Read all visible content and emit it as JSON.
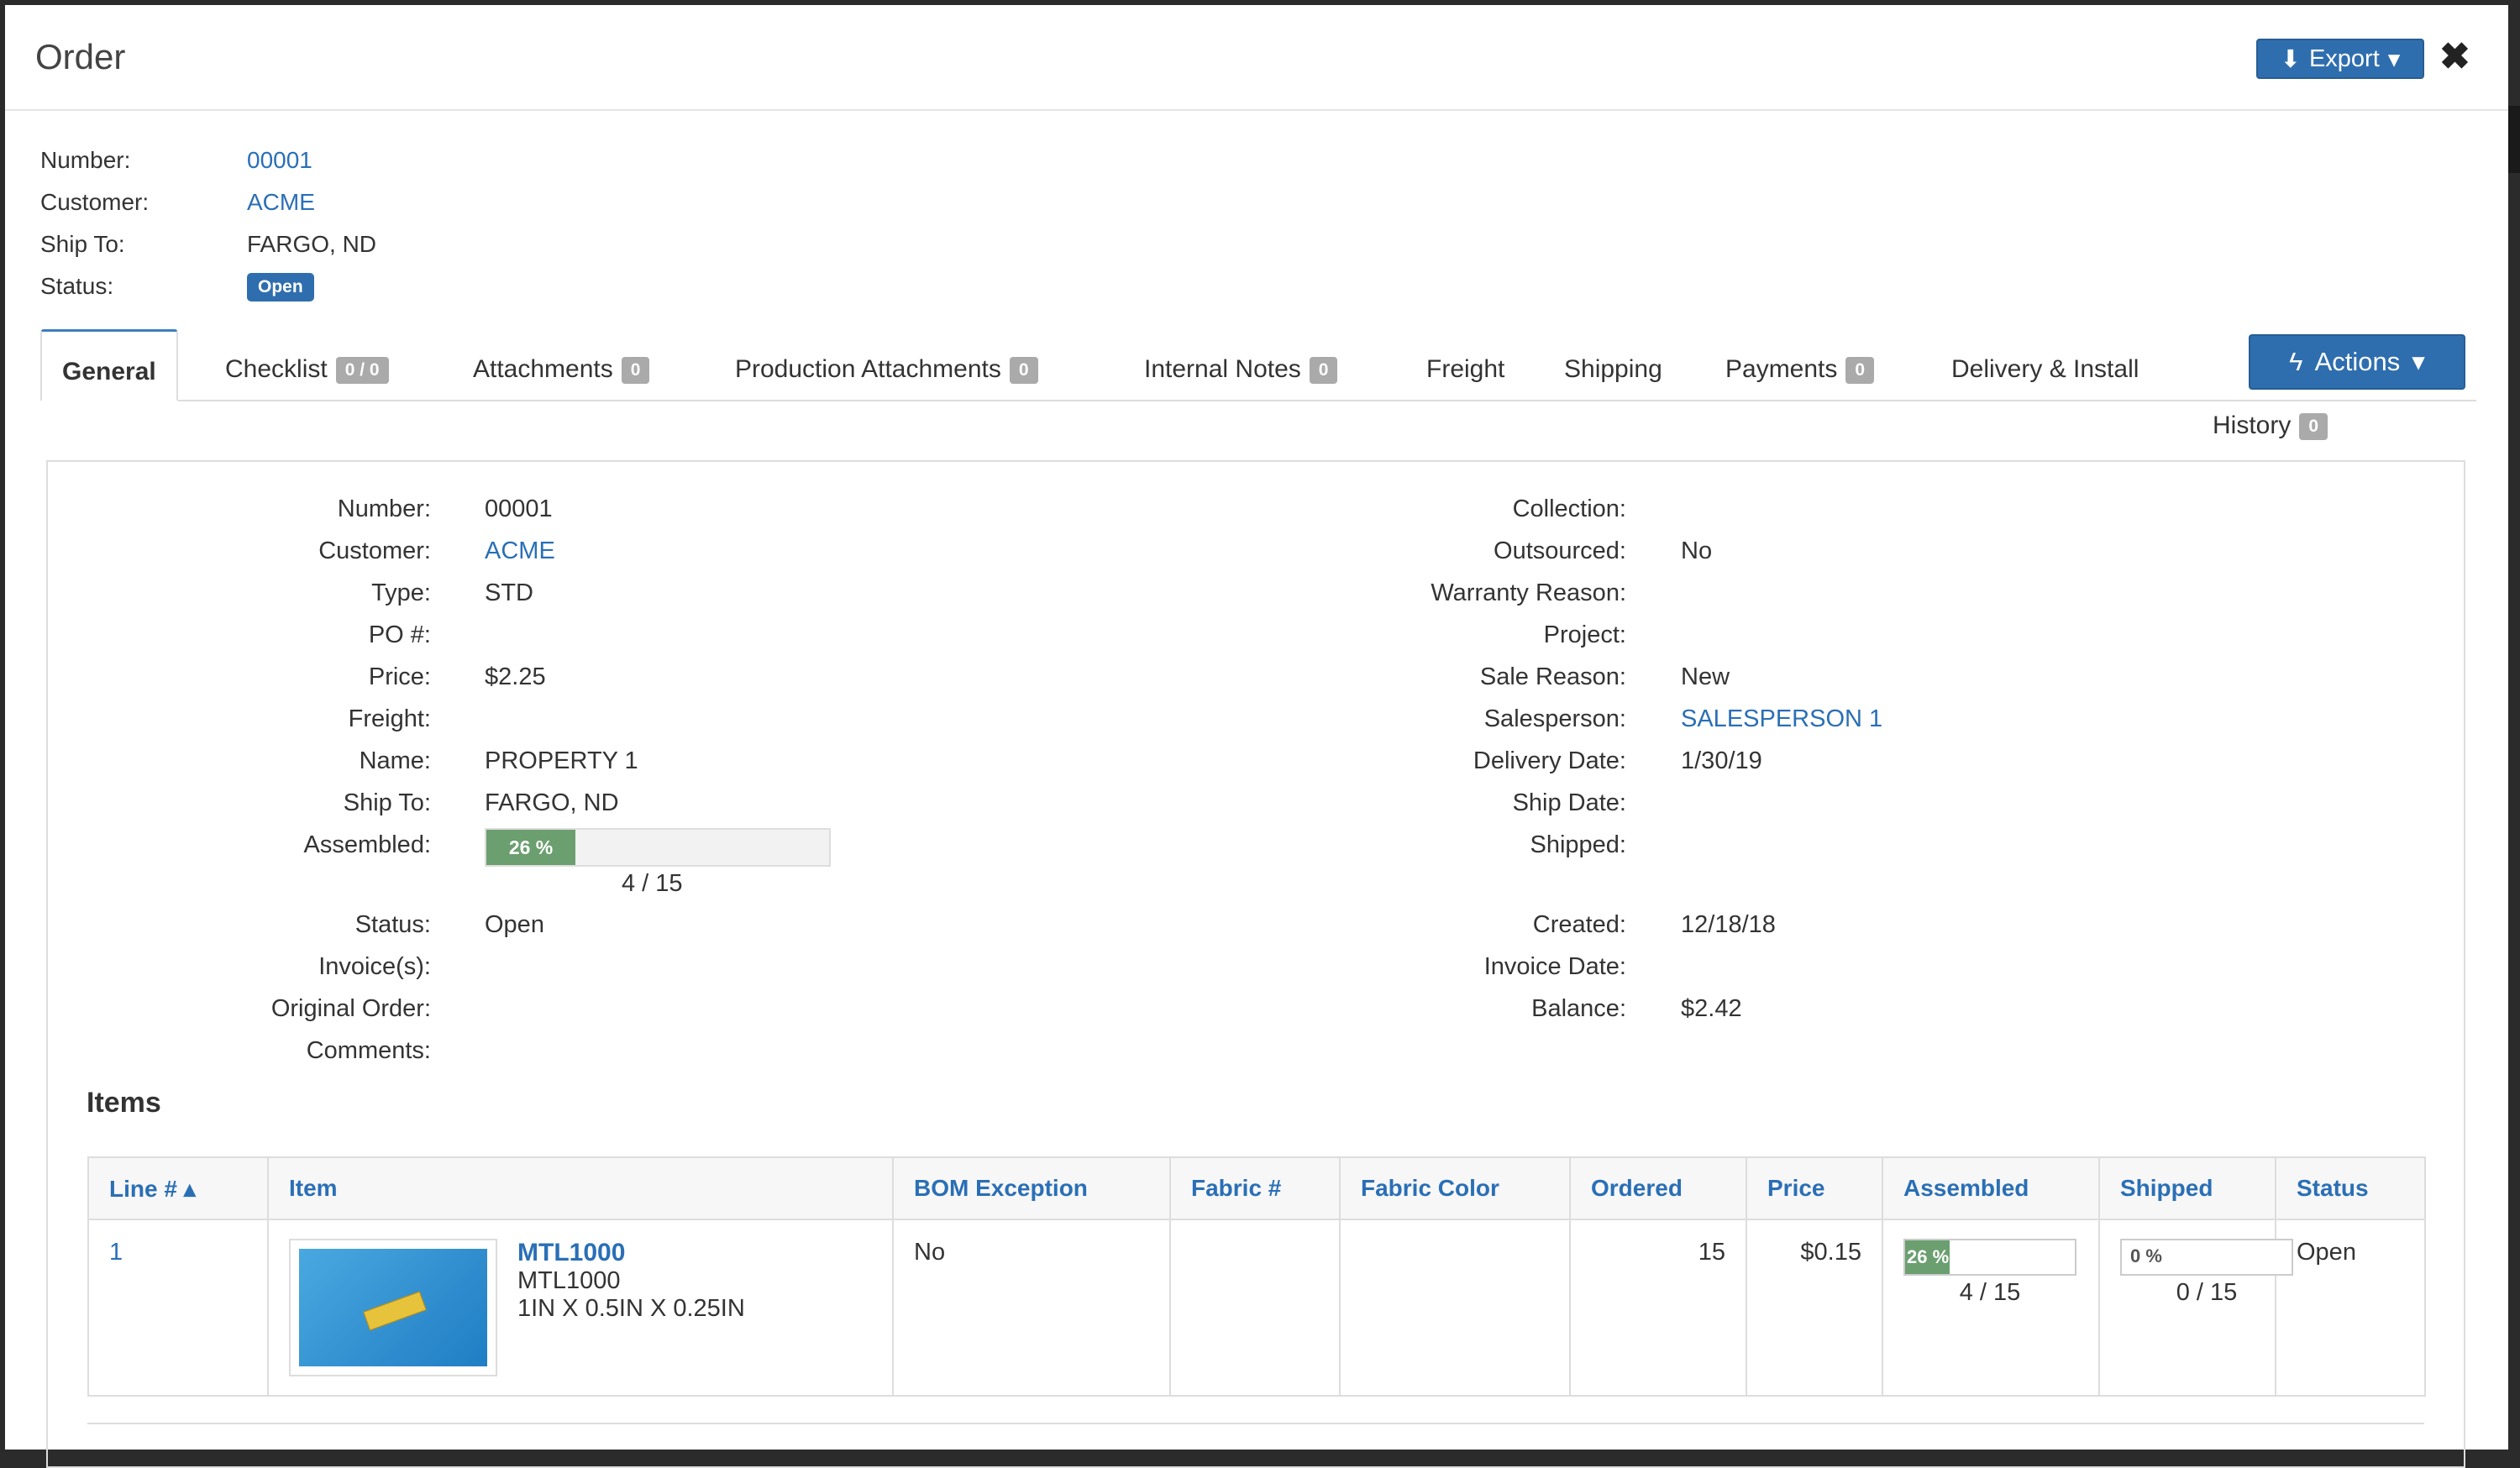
{
  "modal": {
    "title": "Order",
    "export_label": "Export",
    "close_symbol": "✖"
  },
  "header": {
    "number_label": "Number:",
    "number": "00001",
    "customer_label": "Customer:",
    "customer": "ACME",
    "shipto_label": "Ship To:",
    "shipto": "FARGO, ND",
    "status_label": "Status:",
    "status": "Open"
  },
  "tabs": [
    {
      "label": "General"
    },
    {
      "label": "Checklist",
      "count": "0 / 0"
    },
    {
      "label": "Attachments",
      "count": "0"
    },
    {
      "label": "Production Attachments",
      "count": "0"
    },
    {
      "label": "Internal Notes",
      "count": "0"
    },
    {
      "label": "Freight"
    },
    {
      "label": "Shipping"
    },
    {
      "label": "Payments",
      "count": "0"
    },
    {
      "label": "Delivery & Install"
    },
    {
      "label": "History",
      "count": "0"
    }
  ],
  "actions_label": "Actions",
  "left_fields": [
    {
      "label": "Number:",
      "value": "00001"
    },
    {
      "label": "Customer:",
      "value": "ACME"
    },
    {
      "label": "Type:",
      "value": "STD"
    },
    {
      "label": "PO #:",
      "value": ""
    },
    {
      "label": "Price:",
      "value": "$2.25"
    },
    {
      "label": "Freight:",
      "value": ""
    },
    {
      "label": "Name:",
      "value": "PROPERTY 1"
    },
    {
      "label": "Ship To:",
      "value": "FARGO, ND"
    },
    {
      "label": "Assembled:",
      "value": ""
    },
    {
      "label": "Status:",
      "value": "Open"
    },
    {
      "label": "Invoice(s):",
      "value": ""
    },
    {
      "label": "Original Order:",
      "value": ""
    },
    {
      "label": "Comments:",
      "value": ""
    }
  ],
  "assembled": {
    "percent_text": "26 %",
    "fraction": 0.26,
    "caption": "4 / 15"
  },
  "right_fields": [
    {
      "label": "Collection:",
      "value": ""
    },
    {
      "label": "Outsourced:",
      "value": "No"
    },
    {
      "label": "Warranty Reason:",
      "value": ""
    },
    {
      "label": "Project:",
      "value": ""
    },
    {
      "label": "Sale Reason:",
      "value": "New"
    },
    {
      "label": "Salesperson:",
      "value": "SALESPERSON 1"
    },
    {
      "label": "Delivery Date:",
      "value": "1/30/19"
    },
    {
      "label": "Ship Date:",
      "value": ""
    },
    {
      "label": "Shipped:",
      "value": ""
    },
    {
      "label": "Created:",
      "value": "12/18/18"
    },
    {
      "label": "Invoice Date:",
      "value": ""
    },
    {
      "label": "Balance:",
      "value": "$2.42"
    }
  ],
  "items": {
    "heading": "Items",
    "columns": [
      "Line # ▴",
      "Item",
      "BOM Exception",
      "Fabric #",
      "Fabric Color",
      "Ordered",
      "Price",
      "Assembled",
      "Shipped",
      "Status"
    ],
    "rows": [
      {
        "line": "1",
        "item_code": "MTL1000",
        "item_desc": "MTL1000",
        "item_dims": "1IN X 0.5IN X 0.25IN",
        "bom_exception": "No",
        "fabric_no": "",
        "fabric_color": "",
        "ordered": "15",
        "price": "$0.15",
        "assembled_text": "26 %",
        "assembled_fraction": 0.26,
        "assembled_caption": "4 / 15",
        "shipped_text": "0 %",
        "shipped_caption": "0 / 15",
        "status": "Open"
      }
    ]
  }
}
